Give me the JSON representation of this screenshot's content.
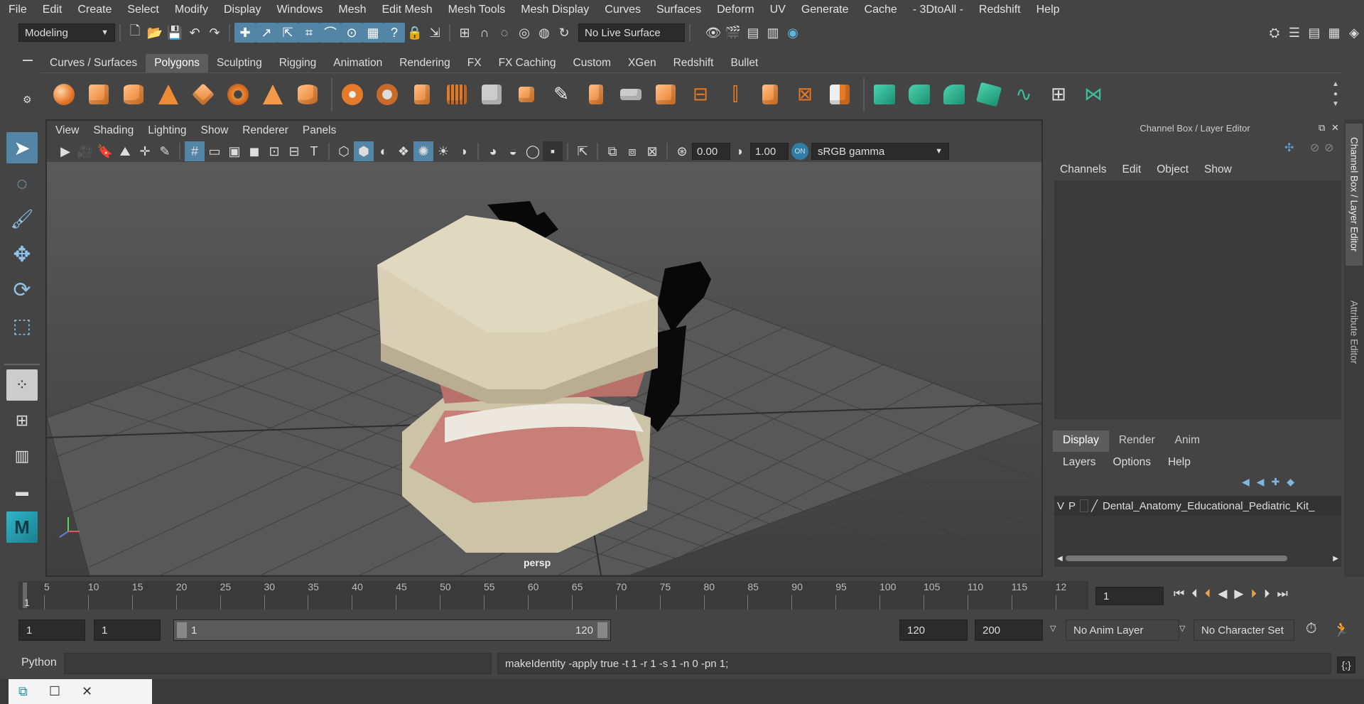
{
  "menubar": {
    "items": [
      "File",
      "Edit",
      "Create",
      "Select",
      "Modify",
      "Display",
      "Windows",
      "Mesh",
      "Edit Mesh",
      "Mesh Tools",
      "Mesh Display",
      "Curves",
      "Surfaces",
      "Deform",
      "UV",
      "Generate",
      "Cache",
      "- 3DtoAll -",
      "Redshift",
      "Help"
    ]
  },
  "status": {
    "mode": "Modeling",
    "live_surface": "No Live Surface"
  },
  "shelf": {
    "tabs": [
      "Curves / Surfaces",
      "Polygons",
      "Sculpting",
      "Rigging",
      "Animation",
      "Rendering",
      "FX",
      "FX Caching",
      "Custom",
      "XGen",
      "Redshift",
      "Bullet"
    ],
    "active_tab": "Polygons"
  },
  "viewport": {
    "menu": [
      "View",
      "Shading",
      "Lighting",
      "Show",
      "Renderer",
      "Panels"
    ],
    "exposure": "0.00",
    "gamma": "1.00",
    "color_space": "sRGB gamma",
    "camera_label": "persp"
  },
  "channel_box": {
    "title": "Channel Box / Layer Editor",
    "menu": [
      "Channels",
      "Edit",
      "Object",
      "Show"
    ]
  },
  "layer_editor": {
    "tabs": [
      "Display",
      "Render",
      "Anim"
    ],
    "active_tab": "Display",
    "menu": [
      "Layers",
      "Options",
      "Help"
    ],
    "layer": {
      "v": "V",
      "p": "P",
      "name": "Dental_Anatomy_Educational_Pediatric_Kit_"
    }
  },
  "side_tabs": [
    "Channel Box / Layer Editor",
    "Attribute Editor"
  ],
  "timeline": {
    "ticks": [
      "5",
      "10",
      "15",
      "20",
      "25",
      "30",
      "35",
      "40",
      "45",
      "50",
      "55",
      "60",
      "65",
      "70",
      "75",
      "80",
      "85",
      "90",
      "95",
      "100",
      "105",
      "110",
      "115",
      "12"
    ],
    "start_marker": "1",
    "current_frame": "1"
  },
  "range": {
    "start": "1",
    "start2": "1",
    "slider_start": "1",
    "slider_end": "120",
    "end": "120",
    "end2": "200",
    "anim_layer": "No Anim Layer",
    "char_set": "No Character Set"
  },
  "command": {
    "lang": "Python",
    "output": "makeIdentity -apply true -t 1 -r 1 -s 1 -n 0 -pn 1;"
  }
}
